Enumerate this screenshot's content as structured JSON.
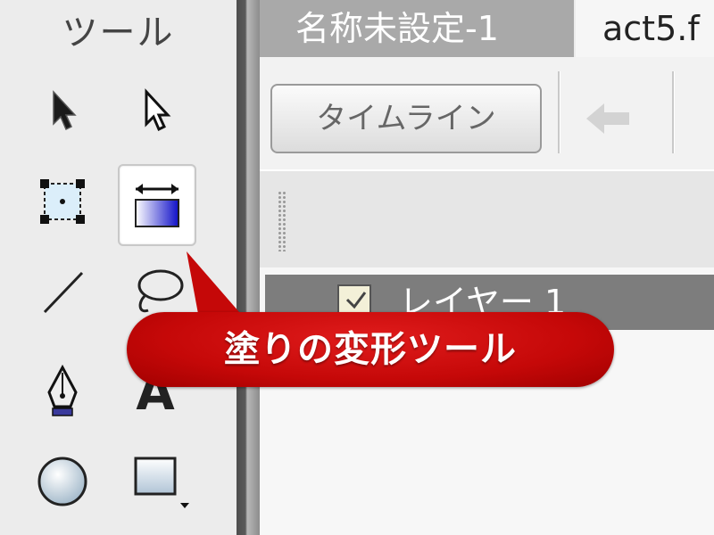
{
  "tools_panel": {
    "title": "ツール",
    "tools": [
      {
        "icon": "selection-arrow-icon",
        "selected": false
      },
      {
        "icon": "subselection-arrow-icon",
        "selected": false
      },
      {
        "icon": "free-transform-icon",
        "selected": false
      },
      {
        "icon": "fill-transform-icon",
        "selected": true
      },
      {
        "icon": "line-icon",
        "selected": false
      },
      {
        "icon": "lasso-icon",
        "selected": false
      },
      {
        "icon": "pen-icon",
        "selected": false
      },
      {
        "icon": "text-icon",
        "selected": false,
        "glyph": "A"
      },
      {
        "icon": "oval-icon",
        "selected": false
      },
      {
        "icon": "rectangle-icon",
        "selected": false
      }
    ]
  },
  "tabs": [
    {
      "label": "名称未設定-1",
      "active": false
    },
    {
      "label": "act5.f",
      "active": true
    }
  ],
  "toolbar": {
    "timeline_label": "タイムライン",
    "back_icon": "back-arrow-icon"
  },
  "stage": {
    "layer_name": "レイヤー 1"
  },
  "callout": {
    "text": "塗りの変形ツール",
    "color": "#c50808"
  }
}
